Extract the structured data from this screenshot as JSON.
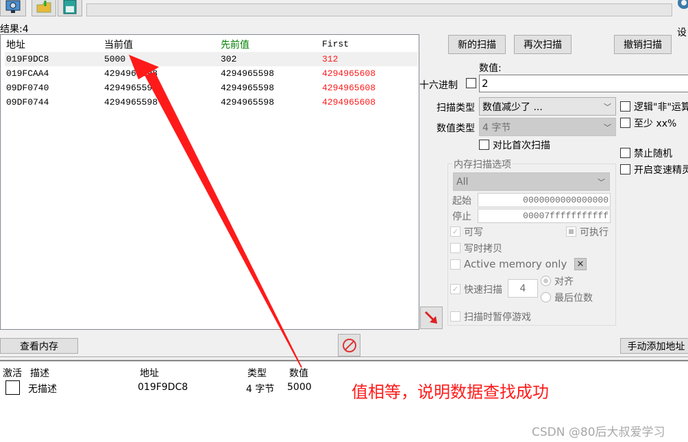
{
  "toolbar": {
    "icons": [
      "open-process-icon",
      "open-file-icon",
      "save-icon"
    ],
    "settings_label": "设"
  },
  "results_label": "结果:4",
  "results": {
    "columns": [
      "地址",
      "当前值",
      "先前值",
      "First"
    ],
    "rows": [
      {
        "address": "019F9DC8",
        "current": "5000",
        "previous": "302",
        "first": "312",
        "selected": true
      },
      {
        "address": "019FCAA4",
        "current": "4294965598",
        "previous": "4294965598",
        "first": "4294965608"
      },
      {
        "address": "09DF0740",
        "current": "4294965598",
        "previous": "4294965598",
        "first": "4294965608"
      },
      {
        "address": "09DF0744",
        "current": "4294965598",
        "previous": "4294965598",
        "first": "4294965608"
      }
    ]
  },
  "scan": {
    "new_scan": "新的扫描",
    "next_scan": "再次扫描",
    "undo_scan": "撤销扫描",
    "value_label": "数值:",
    "hex_label": "十六进制",
    "value": "2",
    "scan_type_label": "扫描类型",
    "scan_type": "数值减少了 ...",
    "value_type_label": "数值类型",
    "value_type": "4 字节",
    "compare_first": "对比首次扫描",
    "not_op": "逻辑\"非\"运算",
    "at_least": "至少 xx%",
    "no_random": "禁止随机",
    "speedhack": "开启变速精灵"
  },
  "memory_options": {
    "title": "内存扫描选项",
    "region": "All",
    "start_label": "起始",
    "start": "0000000000000000",
    "stop_label": "停止",
    "stop": "00007fffffffffff",
    "writable": "可写",
    "executable": "可执行",
    "copy_on_write": "写时拷贝",
    "active_only": "Active memory only",
    "fast_scan": "快速扫描",
    "fast_scan_value": "4",
    "aligned": "对齐",
    "last_digits": "最后位数",
    "pause_game": "扫描时暂停游戏"
  },
  "bottom": {
    "view_memory": "查看内存",
    "add_address": "手动添加地址"
  },
  "cheat_table": {
    "columns": [
      "激活",
      "描述",
      "地址",
      "类型",
      "数值"
    ],
    "rows": [
      {
        "active": false,
        "description": "无描述",
        "address": "019F9DC8",
        "type": "4 字节",
        "value": "5000"
      }
    ]
  },
  "annotation": "值相等，说明数据查找成功",
  "watermark": "CSDN @80后大叔爱学习",
  "colors": {
    "previous_header": "#008000",
    "first_changed": "#ff1a1a",
    "annotation": "#ff1a1a"
  }
}
